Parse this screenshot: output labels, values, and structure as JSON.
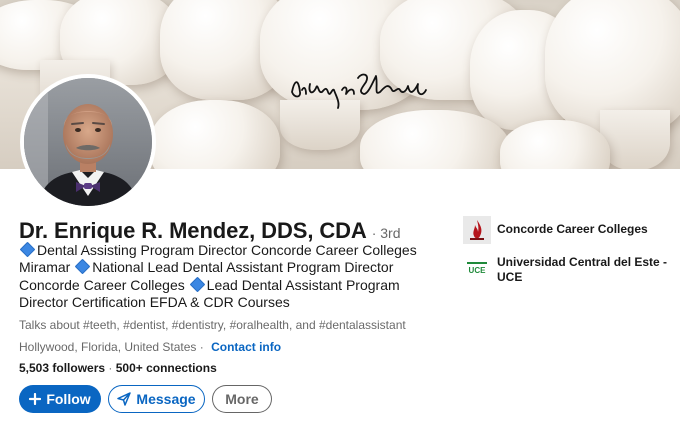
{
  "banner": {
    "signature_text": "Dr. Enrique R Méndez"
  },
  "profile": {
    "name": "Dr. Enrique R. Mendez, DDS, CDA",
    "degree": "· 3rd",
    "headline_parts": [
      "Dental Assisting Program Director Concorde Career Colleges Miramar",
      "National Lead Dental Assistant Program Director Concorde Career Colleges",
      "Lead Dental Assistant Program Director Certification EFDA & CDR Courses"
    ],
    "talks_about": "Talks about #teeth, #dentist, #dentistry, #oralhealth, and #dentalassistant",
    "location": "Hollywood, Florida, United States ·",
    "contact_info_label": "Contact info",
    "followers": "5,503 followers",
    "connections_sep": " · ",
    "connections": "500+ connections"
  },
  "actions": {
    "follow_label": "Follow",
    "message_label": "Message",
    "more_label": "More"
  },
  "organizations": [
    {
      "name": "Concorde Career Colleges",
      "logo": "concorde-flame-logo"
    },
    {
      "name": "Universidad Central del Este - UCE",
      "logo": "uce-logo",
      "logo_text": "UCE"
    }
  ],
  "colors": {
    "primary": "#0a66c2",
    "diamond": "#3b87e3"
  }
}
